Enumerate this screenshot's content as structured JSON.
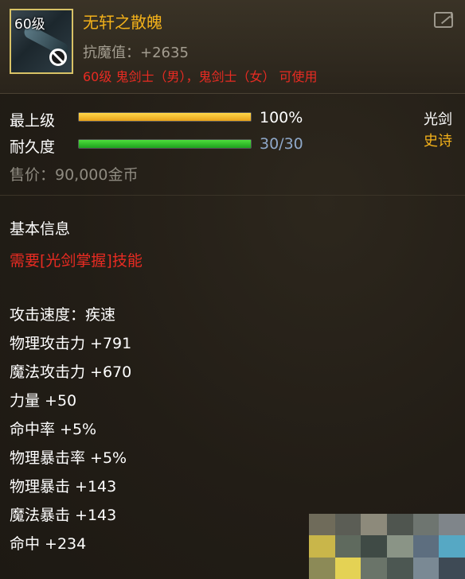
{
  "item": {
    "level_tag": "60级",
    "name": "无轩之散魄",
    "magic_resist": "抗魔值：+2635",
    "usable": "60级 鬼剑士（男），鬼剑士（女） 可使用",
    "icon": "sword-icon"
  },
  "status": {
    "grade_label": "最上级",
    "grade_value": "100%",
    "grade_fraction": 1.0,
    "durability_label": "耐久度",
    "durability_value": "30/30",
    "durability_fraction": 1.0,
    "weapon_type": "光剑",
    "rarity": "史诗"
  },
  "price": "售价：90,000金币",
  "basic_info": {
    "title": "基本信息",
    "requirement": "需要[光剑掌握]技能"
  },
  "stats": [
    "攻击速度：疾速",
    "物理攻击力 +791",
    "魔法攻击力 +670",
    "力量 +50",
    "命中率 +5%",
    "物理暴击率 +5%",
    "物理暴击 +143",
    "魔法暴击 +143",
    "命中 +234"
  ],
  "colors": {
    "name": "#f3b11a",
    "rarity": "#f3b11a",
    "warning": "#e82b22",
    "durability_text": "#8fa8c9",
    "muted": "#a39d90"
  }
}
